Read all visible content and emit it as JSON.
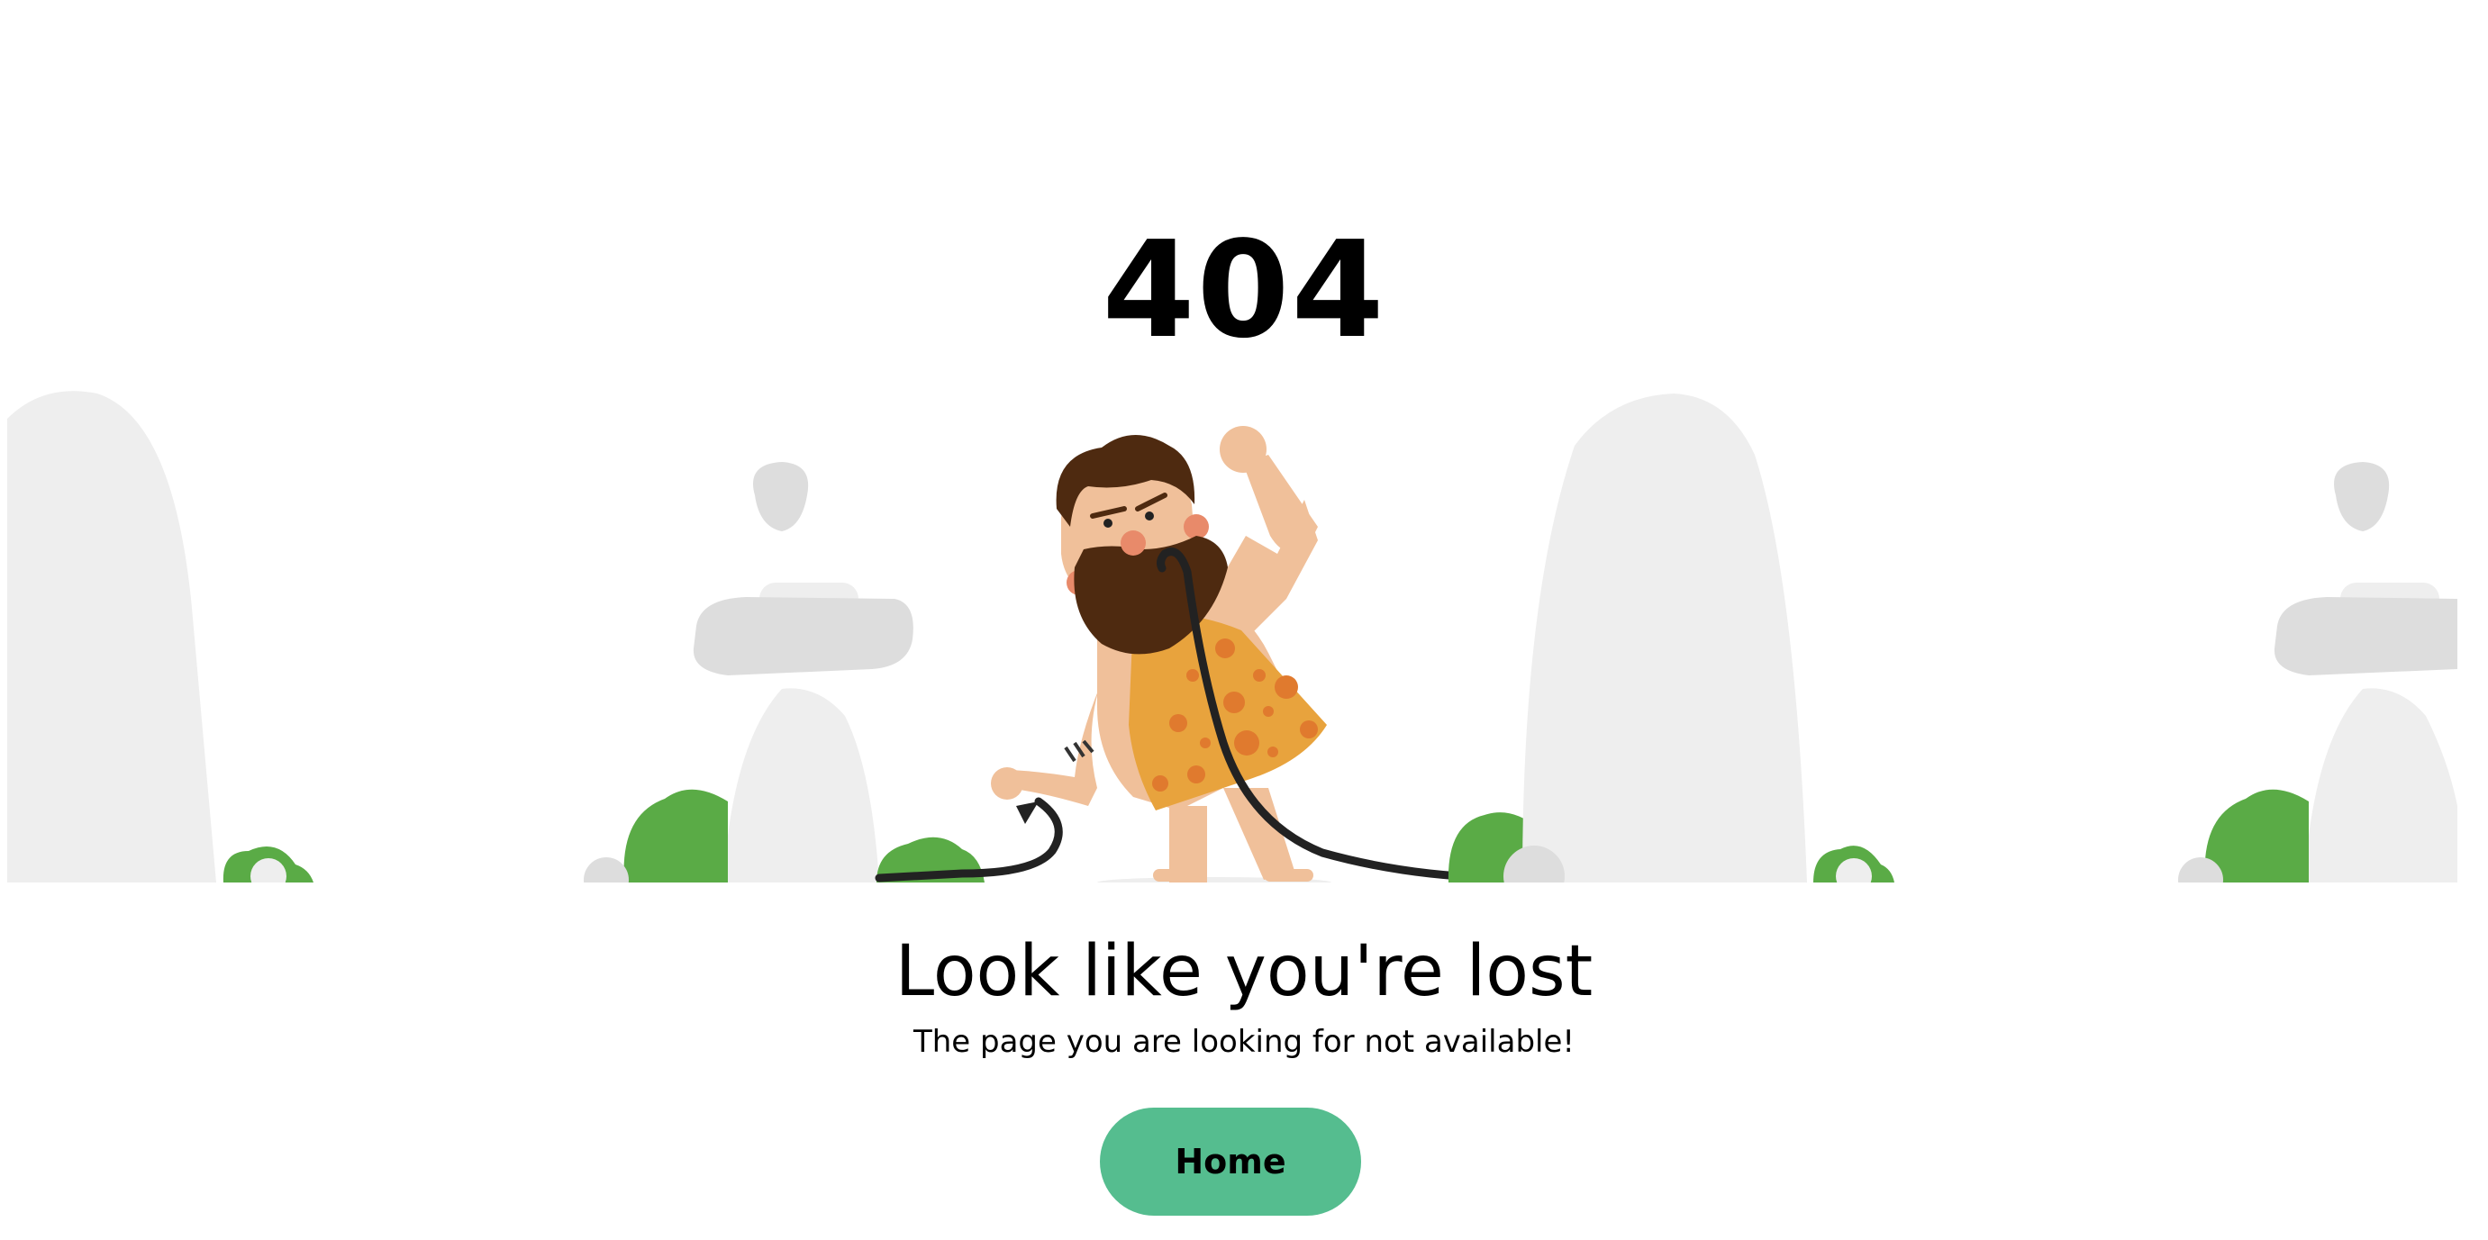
{
  "error": {
    "code": "404"
  },
  "message": {
    "headline": "Look like you're lost",
    "subtext": "The page you are looking for not available!"
  },
  "actions": {
    "home_label": "Home"
  },
  "colors": {
    "button_background": "#55bd8f",
    "rock": "#eeeeee",
    "rock_dark": "#dddddd",
    "bush": "#5aab46",
    "skin": "#f0c09a",
    "beard": "#4e2a10",
    "tunic": "#e8a33d",
    "tunic_spots": "#e07a2e",
    "cable": "#222222"
  },
  "illustration": {
    "icon": "caveman-chewing-cable-illustration"
  }
}
